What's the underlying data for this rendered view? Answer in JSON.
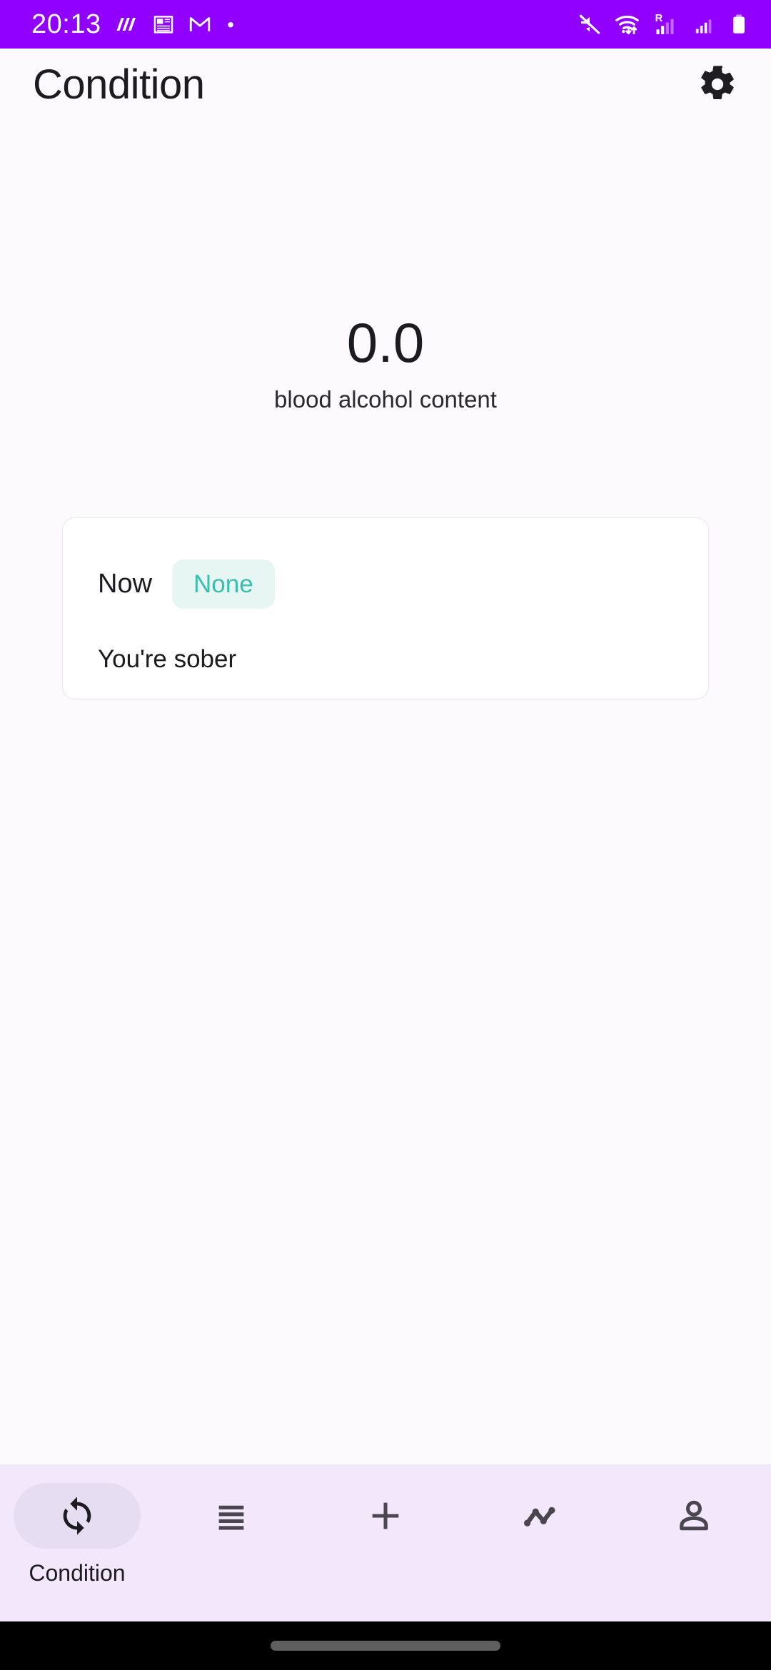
{
  "status_bar": {
    "time": "20:13",
    "background_color": "#9100FF",
    "notification_icons": [
      "m-app-icon",
      "news-feed-icon",
      "gmail-icon",
      "dot-icon"
    ],
    "system_icons": [
      "mute-icon",
      "wifi-icon",
      "roaming-signal-icon",
      "signal-icon",
      "battery-icon"
    ],
    "roaming_label": "R"
  },
  "app_bar": {
    "title": "Condition",
    "settings_icon": "gear-icon"
  },
  "main": {
    "bac_value": "0.0",
    "bac_label": "blood alcohol content",
    "card": {
      "time_label": "Now",
      "level_chip": "None",
      "chip_bg_color": "#E8F6F3",
      "chip_text_color": "#3BBFAD",
      "description": "You're sober"
    }
  },
  "bottom_nav": {
    "background_color": "#F3E8FB",
    "active_index": 0,
    "items": [
      {
        "label": "Condition",
        "icon": "sync-refresh-icon",
        "active": true
      },
      {
        "label": "",
        "icon": "list-lines-icon",
        "active": false
      },
      {
        "label": "",
        "icon": "plus-icon",
        "active": false
      },
      {
        "label": "",
        "icon": "trend-line-icon",
        "active": false
      },
      {
        "label": "",
        "icon": "person-icon",
        "active": false
      }
    ]
  }
}
